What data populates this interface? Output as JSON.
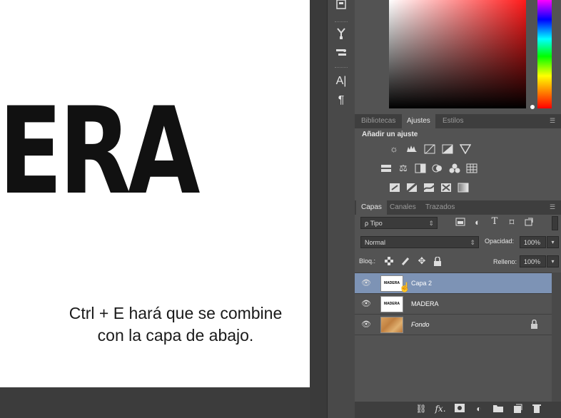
{
  "canvas": {
    "art_text": "ERA",
    "caption": "Ctrl + E hará que se combine con la capa de abajo."
  },
  "tool_strip": {
    "icons": [
      "swatches-icon",
      "brush-presets-icon",
      "clone-source-icon",
      "character-icon",
      "paragraph-icon"
    ],
    "char_glyph": "A|",
    "para_glyph": "¶"
  },
  "adjust_panel": {
    "tabs": [
      "Bibliotecas",
      "Ajustes",
      "Estilos"
    ],
    "active_tab": "Ajustes",
    "heading": "Añadir un ajuste"
  },
  "layers_panel": {
    "tabs": [
      "Capas",
      "Canales",
      "Trazados"
    ],
    "filter_label": "ρ Tipo",
    "blend_mode": "Normal",
    "opacity_label": "Opacidad:",
    "opacity_value": "100%",
    "lock_label": "Bloq.:",
    "fill_label": "Relleno:",
    "fill_value": "100%",
    "layers": [
      {
        "name": "Capa 2",
        "thumb": "MADERA",
        "selected": true
      },
      {
        "name": "MADERA",
        "thumb": "MADERA",
        "selected": false
      },
      {
        "name": "Fondo",
        "thumb": "",
        "selected": false,
        "locked": true
      }
    ]
  },
  "colors": {
    "panel_bg": "#535353",
    "selected_layer": "#7d93b5",
    "tab_bar": "#3e3e3e"
  }
}
